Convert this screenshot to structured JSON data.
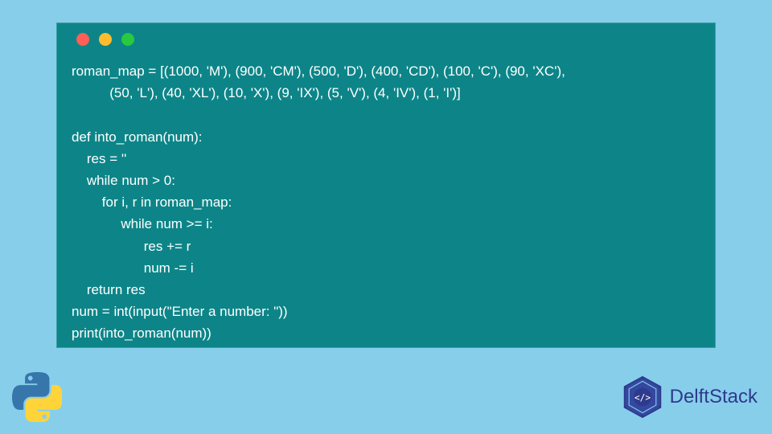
{
  "code": {
    "line1": "roman_map = [(1000, 'M'), (900, 'CM'), (500, 'D'), (400, 'CD'), (100, 'C'), (90, 'XC'),",
    "line2": "          (50, 'L'), (40, 'XL'), (10, 'X'), (9, 'IX'), (5, 'V'), (4, 'IV'), (1, 'I')]",
    "line3": "",
    "line4": "def into_roman(num):",
    "line5": "    res = ''",
    "line6": "    while num > 0:",
    "line7": "        for i, r in roman_map:",
    "line8": "             while num >= i:",
    "line9": "                   res += r",
    "line10": "                   num -= i",
    "line11": "    return res",
    "line12": "num = int(input(\"Enter a number: \"))",
    "line13": "print(into_roman(num))"
  },
  "brand": {
    "name": "DelftStack"
  }
}
